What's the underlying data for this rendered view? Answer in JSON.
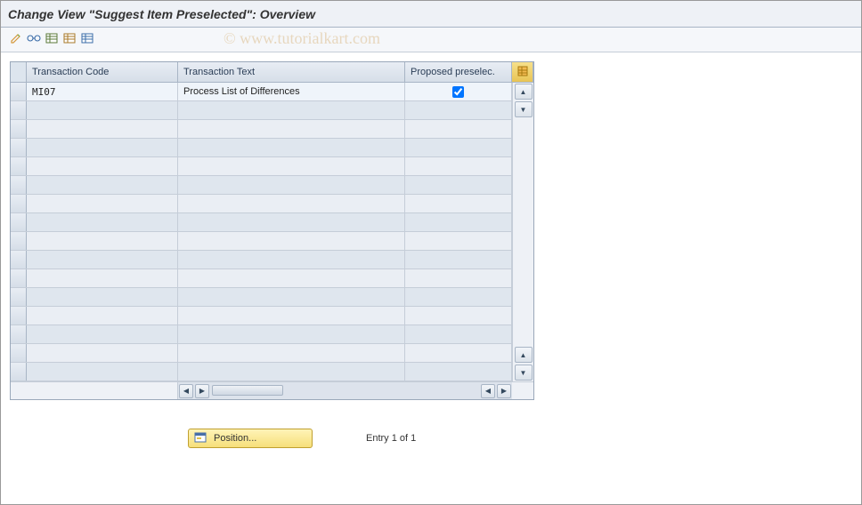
{
  "title": "Change View \"Suggest Item Preselected\": Overview",
  "watermark": "© www.tutorialkart.com",
  "toolbar_icons": {
    "pencil": "pencil-icon",
    "glasses": "glasses-icon",
    "new_entries": "new-entries-icon",
    "copy": "copy-icon",
    "delete": "delete-icon"
  },
  "columns": {
    "tcode": "Transaction Code",
    "ttext": "Transaction Text",
    "presel": "Proposed preselec."
  },
  "rows": [
    {
      "tcode": "MI07",
      "ttext": "Process List of Differences",
      "preselected": true
    }
  ],
  "empty_row_count": 15,
  "footer": {
    "position_label": "Position...",
    "entry_status": "Entry 1 of 1"
  }
}
